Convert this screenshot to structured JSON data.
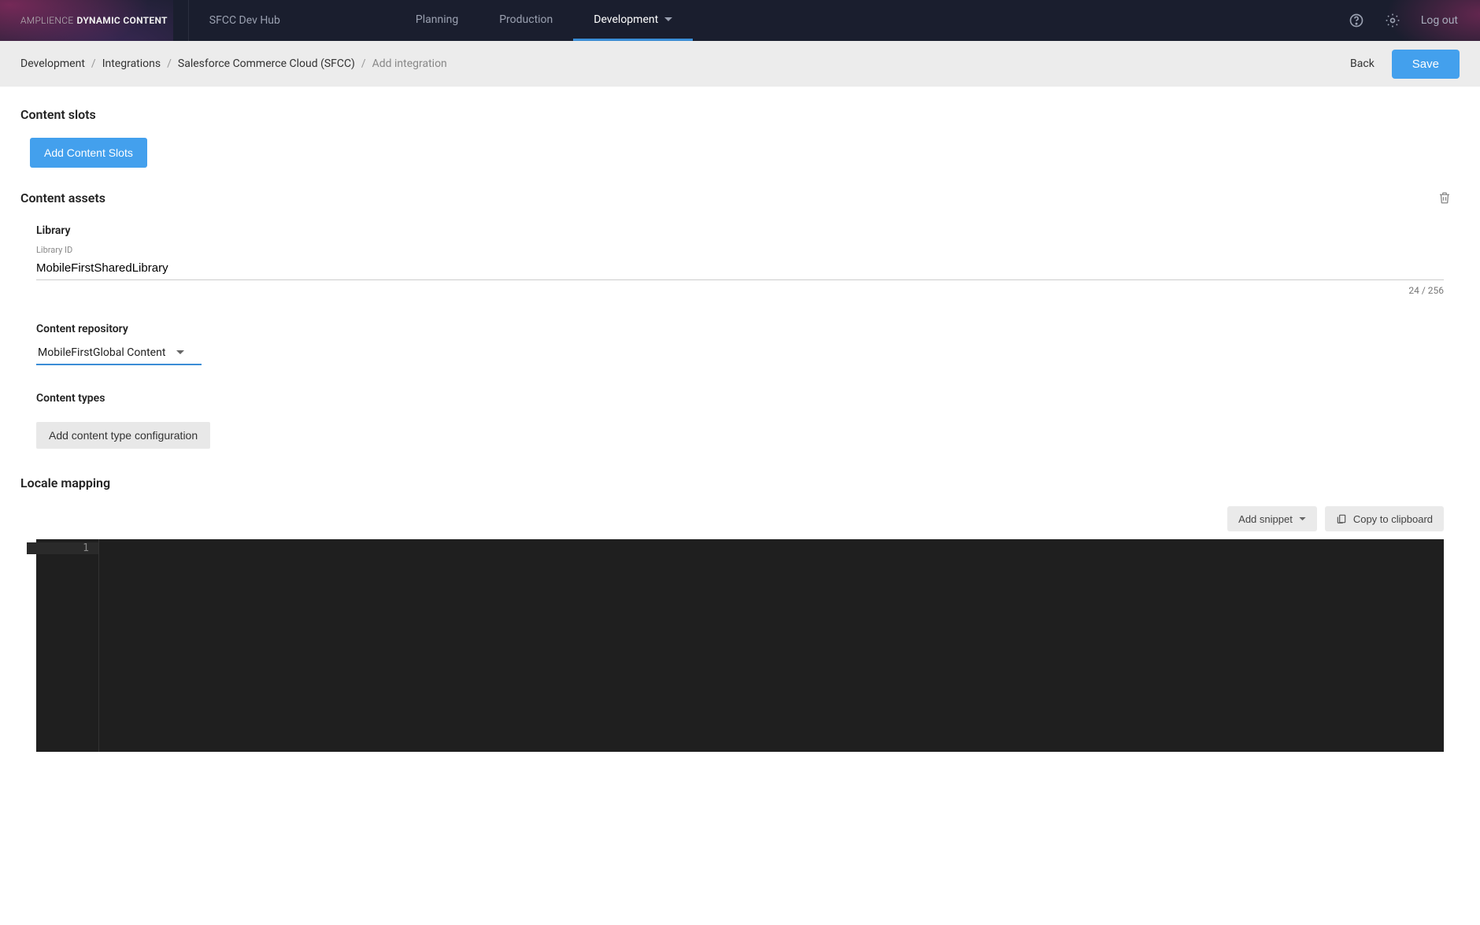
{
  "brand": {
    "thin": "AMPLIENCE",
    "bold": "DYNAMIC CONTENT"
  },
  "hub_label": "SFCC Dev Hub",
  "nav": {
    "items": [
      {
        "label": "Planning",
        "active": false
      },
      {
        "label": "Production",
        "active": false
      },
      {
        "label": "Development",
        "active": true
      }
    ]
  },
  "header": {
    "logout": "Log out"
  },
  "breadcrumb": {
    "items": [
      "Development",
      "Integrations",
      "Salesforce Commerce Cloud (SFCC)"
    ],
    "current": "Add integration"
  },
  "actions": {
    "back": "Back",
    "save": "Save"
  },
  "sections": {
    "content_slots": {
      "title": "Content slots",
      "add_button": "Add Content Slots"
    },
    "content_assets": {
      "title": "Content assets",
      "library": {
        "label": "Library",
        "sub_label": "Library ID",
        "value": "MobileFirstSharedLibrary",
        "counter": "24 / 256"
      },
      "content_repository": {
        "label": "Content repository",
        "value": "MobileFirstGlobal Content"
      },
      "content_types": {
        "label": "Content types",
        "add_button": "Add content type configuration"
      }
    },
    "locale_mapping": {
      "title": "Locale mapping",
      "toolbar": {
        "add_snippet": "Add snippet",
        "copy": "Copy to clipboard"
      },
      "editor": {
        "line_number": "1",
        "content": ""
      }
    }
  }
}
